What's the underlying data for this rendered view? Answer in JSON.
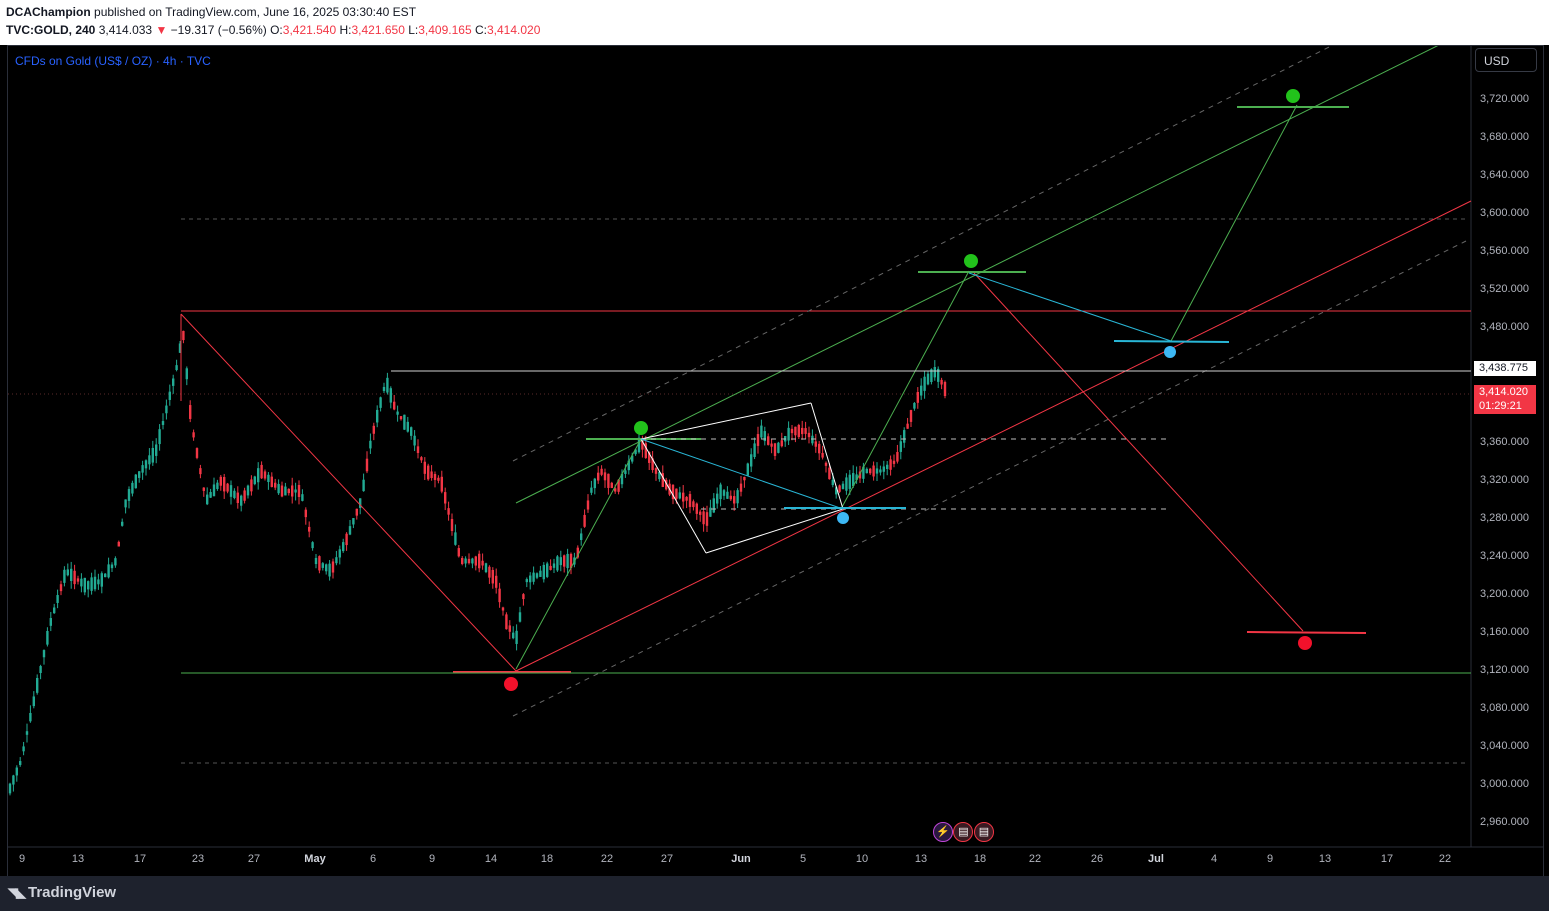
{
  "header": {
    "author": "DCAChampion",
    "published": "published on TradingView.com, June 16, 2025 03:30:40 EST",
    "symbol": "TVC:GOLD, 240",
    "last": "3,414.033",
    "arrow": "▼",
    "change": "−19.317 (−0.56%)",
    "o_label": "O:",
    "o": "3,421.540",
    "h_label": "H:",
    "h": "3,421.650",
    "l_label": "L:",
    "l": "3,409.165",
    "c_label": "C:",
    "c": "3,414.020"
  },
  "legend": {
    "title": "CFDs on Gold (US$ / OZ) · 4h · TVC"
  },
  "currency_button": "USD",
  "price_axis": {
    "labels": [
      "3,720.000",
      "3,680.000",
      "3,640.000",
      "3,600.000",
      "3,560.000",
      "3,520.000",
      "3,480.000",
      "3,360.000",
      "3,320.000",
      "3,280.000",
      "3,240.000",
      "3,200.000",
      "3,160.000",
      "3,120.000",
      "3,080.000",
      "3,040.000",
      "3,000.000",
      "2,960.000"
    ],
    "hline_tag": "3,438.775",
    "price_tag": "3,414.020",
    "countdown": "01:29:21"
  },
  "time_axis": {
    "labels": [
      "9",
      "13",
      "17",
      "23",
      "27",
      "May",
      "6",
      "9",
      "14",
      "18",
      "22",
      "27",
      "Jun",
      "5",
      "10",
      "13",
      "18",
      "22",
      "26",
      "Jul",
      "4",
      "9",
      "13",
      "17",
      "22"
    ],
    "bold": [
      "May",
      "Jun",
      "Jul"
    ]
  },
  "colors": {
    "bull": "#22ab94",
    "bear": "#f23645",
    "green_line": "#4caf50",
    "red_line": "#f23645",
    "cyan_line": "#29b6d6",
    "white_line": "#ffffff",
    "dashed": "#787b86"
  },
  "icons": [
    "lightning-icon",
    "us-flag-icon",
    "us-flag-icon"
  ],
  "footer": {
    "brand": "TradingView"
  }
}
